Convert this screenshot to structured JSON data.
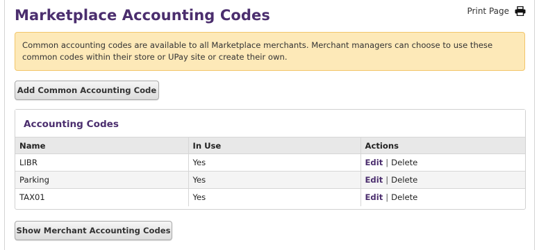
{
  "page": {
    "title": "Marketplace Accounting Codes",
    "print_label": "Print Page",
    "print_icon": "printer-icon"
  },
  "alert": {
    "text": "Common accounting codes are available to all Marketplace merchants. Merchant managers can choose to use these common codes within their store or UPay site or create their own."
  },
  "buttons": {
    "add_common": "Add Common Accounting Code",
    "show_merchant": "Show Merchant Accounting Codes"
  },
  "panel": {
    "title": "Accounting Codes",
    "columns": [
      "Name",
      "In Use",
      "Actions"
    ],
    "rows": [
      {
        "name": "LIBR",
        "in_use": "Yes",
        "edit": "Edit",
        "sep": "|",
        "delete": "Delete"
      },
      {
        "name": "Parking",
        "in_use": "Yes",
        "edit": "Edit",
        "sep": "|",
        "delete": "Delete"
      },
      {
        "name": "TAX01",
        "in_use": "Yes",
        "edit": "Edit",
        "sep": "|",
        "delete": "Delete"
      }
    ]
  },
  "colors": {
    "title": "#4b2e6e",
    "alert_bg": "#fde9b8",
    "alert_border": "#f2c56a"
  }
}
